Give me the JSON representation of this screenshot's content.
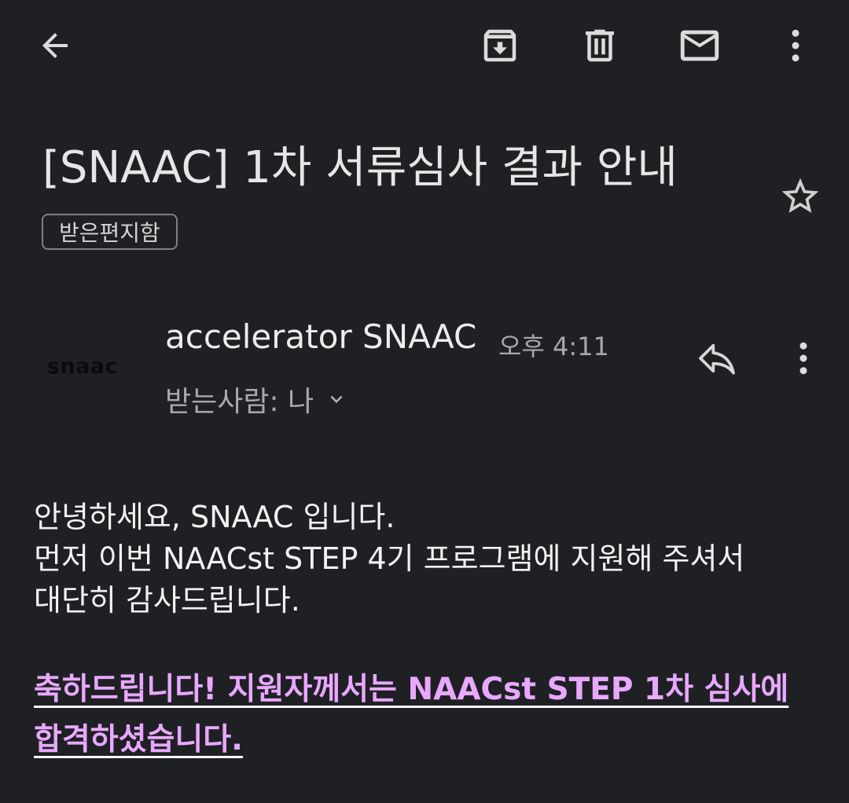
{
  "toolbar": {
    "back_icon": "arrow-left-icon",
    "archive_icon": "archive-icon",
    "delete_icon": "trash-icon",
    "mark_unread_icon": "mail-icon",
    "more_icon": "more-vert-icon"
  },
  "email": {
    "subject": "[SNAAC] 1차 서류심사 결과 안내",
    "label": "받은편지함",
    "starred": false,
    "sender": {
      "avatar_text": "snaac",
      "name": "accelerator SNAAC",
      "time": "오후 4:11",
      "recipients": "받는사람: 나"
    },
    "body": {
      "lines": [
        "안녕하세요, SNAAC 입니다.",
        "먼저 이번 NAACst STEP 4기 프로그램에 지원해 주셔서",
        "대단히 감사드립니다."
      ],
      "highlight_lines": [
        "축하드립니다! 지원자께서는 NAACst STEP 1차 심사에",
        "합격하셨습니다."
      ]
    }
  },
  "colors": {
    "background": "#1f2024",
    "highlight": "#e9a8ff",
    "text": "#f2f2f2",
    "secondary_text": "#a8a8ad"
  }
}
